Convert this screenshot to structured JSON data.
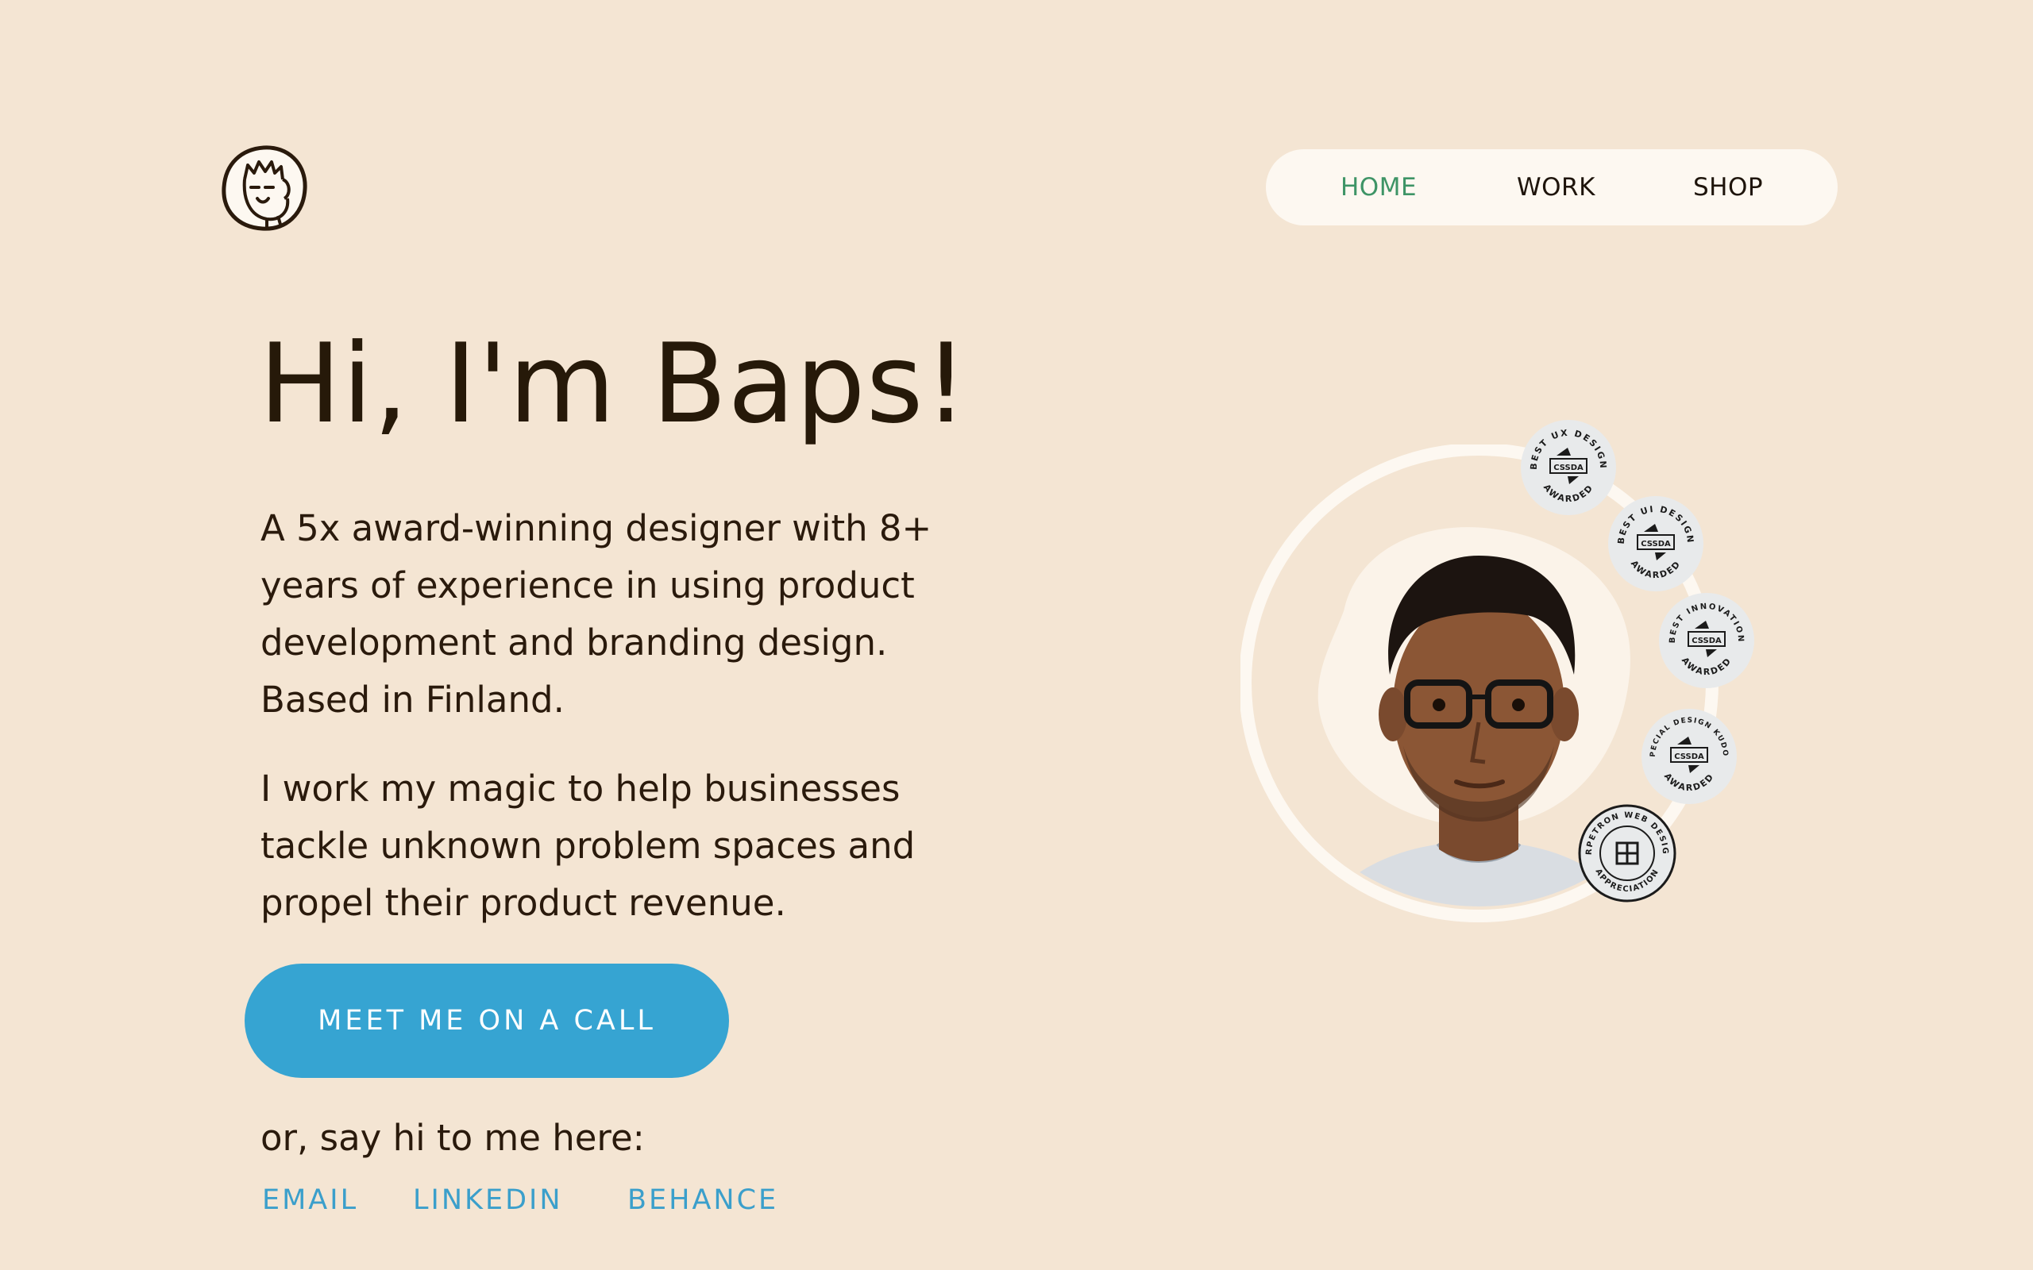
{
  "logo": {
    "icon": "avatar-doodle-icon"
  },
  "nav": {
    "items": [
      {
        "label": "HOME",
        "active": true
      },
      {
        "label": "WORK",
        "active": false
      },
      {
        "label": "SHOP",
        "active": false
      }
    ]
  },
  "hero": {
    "title": "Hi, I'm Baps!",
    "paragraph1": "A 5x award-winning designer with 8+ years of experience in using product development and branding design. Based in Finland.",
    "paragraph2": "I work my magic to help businesses tackle unknown problem spaces and propel their product revenue."
  },
  "cta": {
    "label": "MEET ME ON A CALL"
  },
  "contact": {
    "prompt": "or, say hi to me here:",
    "links": [
      "EMAIL",
      "LINKEDIN",
      "BEHANCE"
    ]
  },
  "badges": [
    {
      "top": "BEST UX DESIGN",
      "center": "CSSDA",
      "bottom": "AWARDED"
    },
    {
      "top": "BEST UI DESIGN",
      "center": "CSSDA",
      "bottom": "AWARDED"
    },
    {
      "top": "BEST INNOVATION",
      "center": "CSSDA",
      "bottom": "AWARDED"
    },
    {
      "top": "SPECIAL DESIGN KUDOS",
      "center": "CSSDA",
      "bottom": "AWARDED"
    },
    {
      "top": "ORPETRON WEB DESIGN",
      "bottom": "APPRECIATION"
    }
  ],
  "colors": {
    "background": "#F4E5D3",
    "nav_bg": "#FDF8F1",
    "accent_green": "#3E9466",
    "cta_blue": "#36A4D2",
    "link_blue": "#3B9FCB",
    "text": "#2A1A0C"
  }
}
